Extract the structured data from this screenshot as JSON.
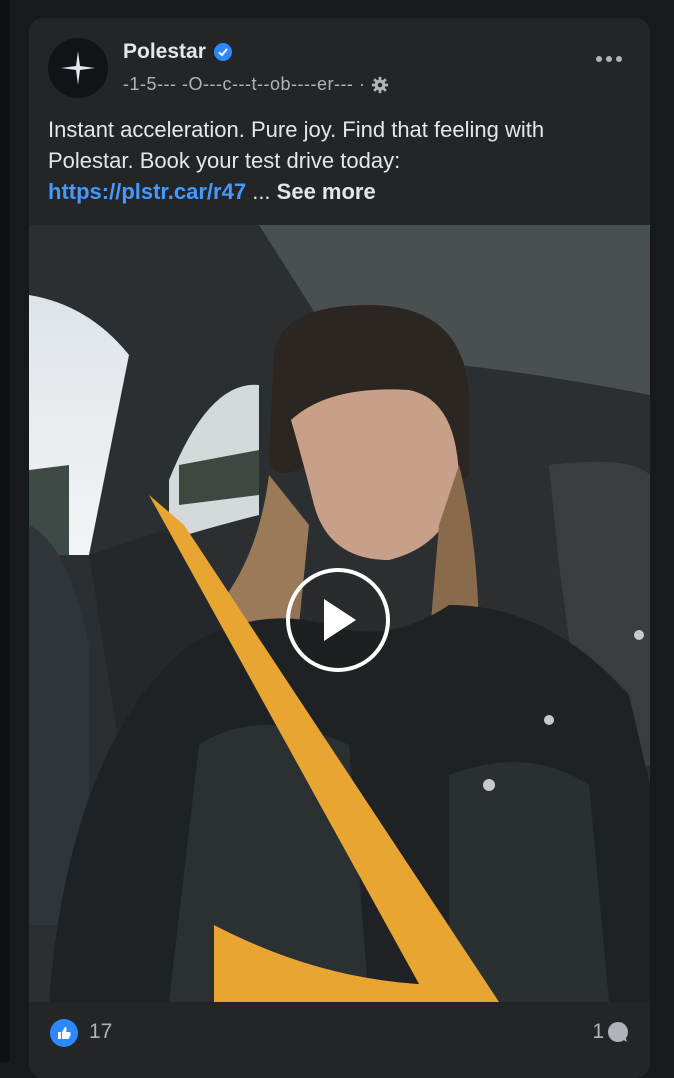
{
  "post": {
    "page_name": "Polestar",
    "verified_icon": "verified-badge-icon",
    "meta_text": "-1-5--- -O---c---t--ob----er--- ·",
    "audience_icon": "gear-icon",
    "caption_text": "Instant acceleration. Pure joy. Find that feeling with Polestar. Book your test drive today:",
    "link_text": "https://plstr.car/r47",
    "ellipsis": "...",
    "see_more_label": "See more",
    "video_play_icon": "play-icon",
    "reaction_icon": "like-icon",
    "reaction_count": "17",
    "comment_count": "1",
    "comment_icon": "comment-icon"
  },
  "colors": {
    "background": "#18191a",
    "card": "#242526",
    "link": "#4599ff",
    "like_blue": "#2d88ff",
    "seatbelt": "#e8a532"
  }
}
